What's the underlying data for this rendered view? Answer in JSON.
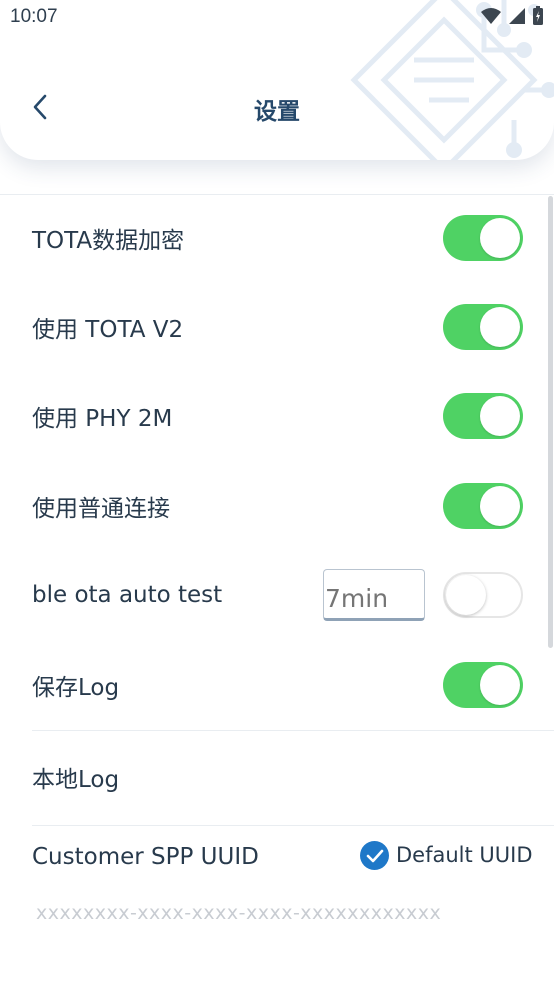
{
  "status_bar": {
    "time": "10:07"
  },
  "header": {
    "title": "设置"
  },
  "settings": [
    {
      "label": "TOTA数据加密",
      "on": true
    },
    {
      "label": "使用 TOTA V2",
      "on": true
    },
    {
      "label": "使用 PHY 2M",
      "on": true
    },
    {
      "label": "使用普通连接",
      "on": true
    },
    {
      "label": "ble ota auto test",
      "on": false,
      "input_placeholder": "7min"
    },
    {
      "label": "保存Log",
      "on": true
    }
  ],
  "local_log": {
    "label": "本地Log"
  },
  "customer_uuid": {
    "label": "Customer SPP UUID",
    "checkbox_label": "Default UUID",
    "checked": true,
    "placeholder": "xxxxxxxx-xxxx-xxxx-xxxx-xxxxxxxxxxxx"
  },
  "colors": {
    "toggle_on": "#4fd264",
    "title": "#26496b",
    "checkbox": "#1f78c8"
  }
}
